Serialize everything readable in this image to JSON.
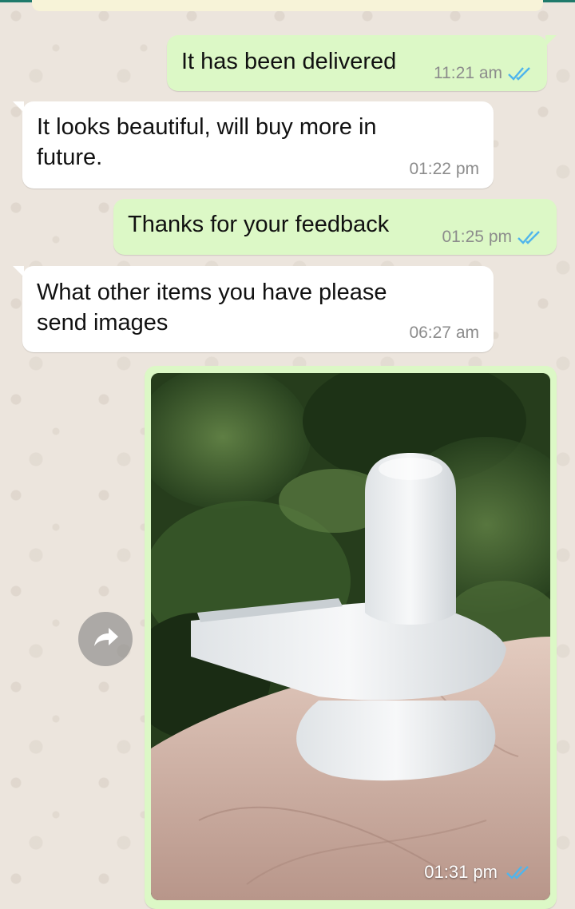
{
  "conversation": {
    "messages": [
      {
        "direction": "outgoing",
        "text": "It has been delivered",
        "time": "11:21 am",
        "status": "read-double-tick"
      },
      {
        "direction": "incoming",
        "text": "It looks beautiful, will buy more in\nfuture.",
        "time": "01:22 pm"
      },
      {
        "direction": "outgoing",
        "text": "Thanks for your feedback",
        "time": "01:25 pm",
        "status": "read-double-tick"
      },
      {
        "direction": "incoming",
        "text": "What other items you have please\nsend images",
        "time": "06:27 am"
      }
    ],
    "image_message": {
      "direction": "outgoing",
      "time": "01:31 pm",
      "status": "read-double-tick",
      "content": "Photo of a white crystal shivling held in a hand, green foliage behind"
    },
    "forward_icon": "forward-arrow-icon"
  },
  "colors": {
    "outgoing_bubble": "#dcf8c6",
    "incoming_bubble": "#ffffff",
    "wallpaper": "#ece5dd",
    "read_tick": "#4fb5ec",
    "time_text": "#8c8c8c"
  }
}
